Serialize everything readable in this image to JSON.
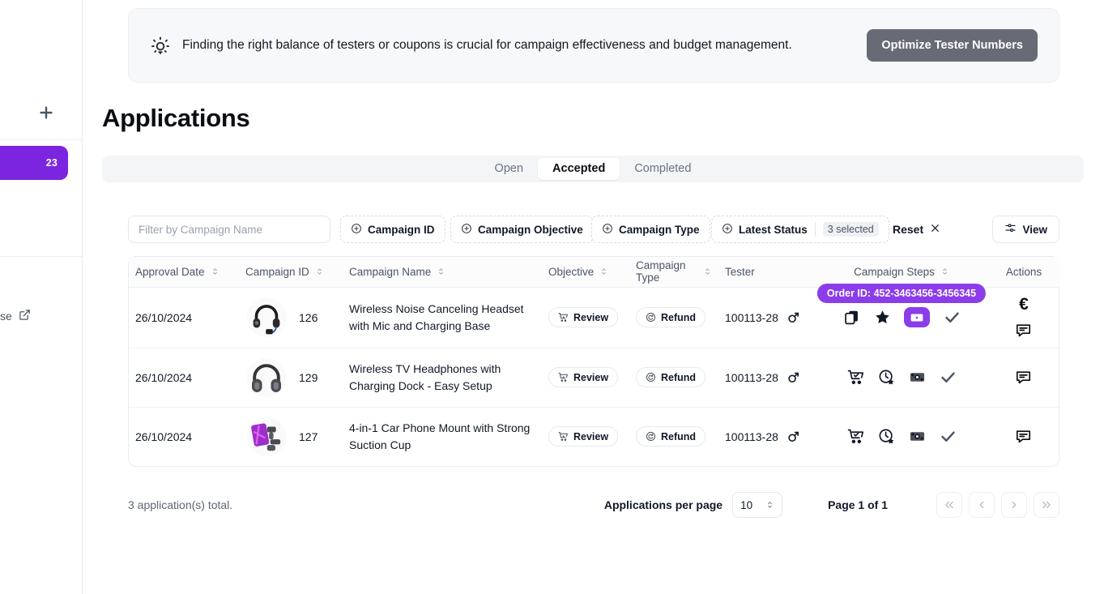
{
  "sidebar": {
    "add_icon": "plus-icon",
    "active_badge": "23",
    "bottom_label": "se",
    "bottom_icon": "external-link-icon"
  },
  "banner": {
    "icon": "lightbulb-icon",
    "text": "Finding the right balance of testers or coupons is crucial for campaign effectiveness and budget management.",
    "button_label": "Optimize Tester Numbers",
    "button_color": "#666b76"
  },
  "page_title": "Applications",
  "tabs": [
    {
      "label": "Open",
      "active": false
    },
    {
      "label": "Accepted",
      "active": true
    },
    {
      "label": "Completed",
      "active": false
    }
  ],
  "filters": {
    "search_placeholder": "Filter by Campaign Name",
    "search_value": "",
    "chips": [
      {
        "label": "Campaign ID",
        "count": ""
      },
      {
        "label": "Campaign Objective",
        "count": ""
      },
      {
        "label": "Campaign Type",
        "count": ""
      },
      {
        "label": "Latest Status",
        "count": "3 selected"
      }
    ],
    "reset_label": "Reset",
    "reset_icon": "close-icon",
    "view_label": "View",
    "view_icon": "sliders-icon"
  },
  "table": {
    "columns": [
      {
        "label": "Approval Date",
        "sortable": true
      },
      {
        "label": "Campaign ID",
        "sortable": true
      },
      {
        "label": "Campaign Name",
        "sortable": true
      },
      {
        "label": "Objective",
        "sortable": true
      },
      {
        "label": "Campaign Type",
        "sortable": true
      },
      {
        "label": "Tester",
        "sortable": false
      },
      {
        "label": "Campaign Steps",
        "sortable": true
      },
      {
        "label": "Actions",
        "sortable": false
      }
    ],
    "rows": [
      {
        "approval_date": "26/10/2024",
        "campaign_id": "126",
        "thumb": "headset-thumb",
        "campaign_name": "Wireless Noise Canceling Headset with Mic and Charging Base",
        "objective": "Review",
        "objective_icon": "cart-star-icon",
        "campaign_type": "Refund",
        "campaign_type_icon": "refund-circle-icon",
        "tester": "100113-28",
        "tester_gender_icon": "male-icon",
        "tooltip": "Order ID: 452-3463456-3456345",
        "steps": [
          {
            "icon": "copy-icon",
            "highlighted": false
          },
          {
            "icon": "star-icon",
            "highlighted": false
          },
          {
            "icon": "banknote-icon",
            "highlighted": true
          },
          {
            "icon": "check-icon",
            "highlighted": false
          }
        ],
        "actions": [
          {
            "icon": "euro-icon",
            "glyph": "€"
          },
          {
            "icon": "message-icon",
            "glyph": ""
          }
        ]
      },
      {
        "approval_date": "26/10/2024",
        "campaign_id": "129",
        "thumb": "headphones-thumb",
        "campaign_name": "Wireless TV Headphones with Charging Dock - Easy Setup",
        "objective": "Review",
        "objective_icon": "cart-star-icon",
        "campaign_type": "Refund",
        "campaign_type_icon": "refund-circle-icon",
        "tester": "100113-28",
        "tester_gender_icon": "male-icon",
        "tooltip": "",
        "steps": [
          {
            "icon": "cart-check-icon",
            "highlighted": false
          },
          {
            "icon": "clock-star-icon",
            "highlighted": false
          },
          {
            "icon": "banknote-icon",
            "highlighted": false
          },
          {
            "icon": "check-icon",
            "highlighted": false
          }
        ],
        "actions": [
          {
            "icon": "message-icon",
            "glyph": ""
          }
        ]
      },
      {
        "approval_date": "26/10/2024",
        "campaign_id": "127",
        "thumb": "phonemount-thumb",
        "campaign_name": "4-in-1 Car Phone Mount with Strong Suction Cup",
        "objective": "Review",
        "objective_icon": "cart-star-icon",
        "campaign_type": "Refund",
        "campaign_type_icon": "refund-circle-icon",
        "tester": "100113-28",
        "tester_gender_icon": "male-icon",
        "tooltip": "",
        "steps": [
          {
            "icon": "cart-check-icon",
            "highlighted": false
          },
          {
            "icon": "clock-star-icon",
            "highlighted": false
          },
          {
            "icon": "banknote-icon",
            "highlighted": false
          },
          {
            "icon": "check-icon",
            "highlighted": false
          }
        ],
        "actions": [
          {
            "icon": "message-icon",
            "glyph": ""
          }
        ]
      }
    ]
  },
  "footer": {
    "total_text": "3 application(s) total.",
    "per_page_label": "Applications per page",
    "per_page_value": "10",
    "page_info": "Page 1 of 1",
    "first_icon": "chevrons-left-icon",
    "prev_icon": "chevron-left-icon",
    "next_icon": "chevron-right-icon",
    "last_icon": "chevrons-right-icon"
  },
  "colors": {
    "accent": "#7c25e0",
    "accent_light": "#8b3dea",
    "banner_bg": "#f7f8fa"
  }
}
